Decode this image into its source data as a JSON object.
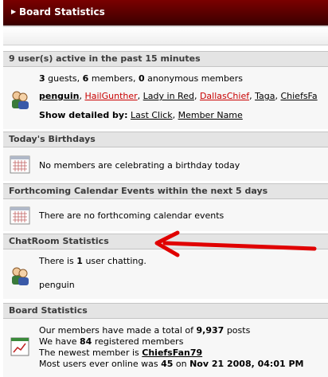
{
  "title": "Board Statistics",
  "active": {
    "heading": "9 user(s) active in the past 15 minutes",
    "guests": "3",
    "guests_label": "guests,",
    "members": "6",
    "members_label": "members,",
    "anon": "0",
    "anon_label": "anonymous members",
    "users": [
      {
        "name": "penguin",
        "style": "bold"
      },
      {
        "name": "HailGunther",
        "style": "red"
      },
      {
        "name": "Lady in Red",
        "style": "normal"
      },
      {
        "name": "DallasChief",
        "style": "red"
      },
      {
        "name": "Taga",
        "style": "normal"
      },
      {
        "name": "ChiefsFa",
        "style": "normal"
      }
    ],
    "show_detailed_label": "Show detailed by:",
    "sort_last_click": "Last Click",
    "sort_member_name": "Member Name"
  },
  "birthdays": {
    "heading": "Today's Birthdays",
    "text": "No members are celebrating a birthday today"
  },
  "calendar": {
    "heading": "Forthcoming Calendar Events within the next 5 days",
    "text": "There are no forthcoming calendar events"
  },
  "chatroom": {
    "heading": "ChatRoom Statistics",
    "line_pre": "There is",
    "count": "1",
    "line_post": "user chatting.",
    "user": "penguin"
  },
  "board": {
    "heading": "Board Statistics",
    "posts_pre": "Our members have made a total of",
    "posts": "9,937",
    "posts_post": "posts",
    "members_pre": "We have",
    "members": "84",
    "members_post": "registered members",
    "newest_pre": "The newest member is",
    "newest": "ChiefsFan79",
    "online_pre": "Most users ever online was",
    "online": "45",
    "online_mid": "on",
    "online_date": "Nov 21 2008, 04:01 PM"
  },
  "colors": {
    "title_bg": "#5a0000",
    "red_user": "#c80000",
    "annotation_arrow": "#e00000"
  }
}
